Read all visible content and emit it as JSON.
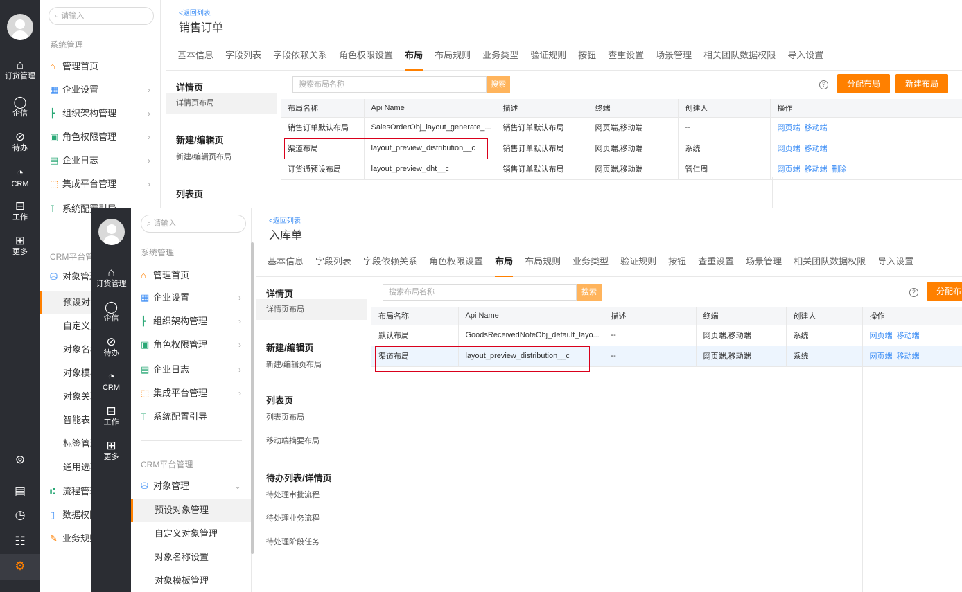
{
  "w1": {
    "rail": [
      {
        "label": "订货管理"
      },
      {
        "label": "企信"
      },
      {
        "label": "待办"
      },
      {
        "label": "CRM"
      },
      {
        "label": "工作"
      },
      {
        "label": "更多"
      }
    ],
    "search_placeholder": "请输入",
    "section_system": "系统管理",
    "menu": [
      "管理首页",
      "企业设置",
      "组织架构管理",
      "角色权限管理",
      "企业日志",
      "集成平台管理",
      "系统配置引导"
    ],
    "section_crm": "CRM平台管",
    "crm_menu": [
      "对象管理",
      "预设对象",
      "自定义对",
      "对象名称",
      "对象模板",
      "对象关联",
      "智能表单",
      "标签管理",
      "通用选项",
      "流程管理",
      "数据权限",
      "业务规则"
    ],
    "back": "<返回列表",
    "title": "销售订单",
    "tabs": [
      "基本信息",
      "字段列表",
      "字段依赖关系",
      "角色权限设置",
      "布局",
      "布局规则",
      "业务类型",
      "验证规则",
      "按钮",
      "查重设置",
      "场景管理",
      "相关团队数据权限",
      "导入设置"
    ],
    "left_nav": {
      "detail_title": "详情页",
      "detail_item": "详情页布局",
      "edit_title": "新建/编辑页",
      "edit_item": "新建/编辑页布局",
      "list_title": "列表页"
    },
    "search_name": "搜索布局名称",
    "search_btn": "搜索",
    "help": "?",
    "assign_btn": "分配布局",
    "new_btn": "新建布局",
    "columns": [
      "布局名称",
      "Api Name",
      "描述",
      "终端",
      "创建人",
      "操作"
    ],
    "rows": [
      {
        "name": "销售订单默认布局",
        "api": "SalesOrderObj_layout_generate_...",
        "desc": "销售订单默认布局",
        "terminal": "网页端,移动端",
        "creator": "--",
        "ops": [
          "网页端",
          "移动端"
        ]
      },
      {
        "name": "渠道布局",
        "api": "layout_preview_distribution__c",
        "desc": "销售订单默认布局",
        "terminal": "网页端,移动端",
        "creator": "系统",
        "ops": [
          "网页端",
          "移动端"
        ]
      },
      {
        "name": "订货通预设布局",
        "api": "layout_preview_dht__c",
        "desc": "销售订单默认布局",
        "terminal": "网页端,移动端",
        "creator": "管仁周",
        "ops": [
          "网页端",
          "移动端",
          "删除"
        ]
      }
    ]
  },
  "w2": {
    "rail": [
      {
        "label": "订货管理"
      },
      {
        "label": "企信"
      },
      {
        "label": "待办"
      },
      {
        "label": "CRM"
      },
      {
        "label": "工作"
      },
      {
        "label": "更多"
      }
    ],
    "search_placeholder": "请输入",
    "section_system": "系统管理",
    "menu": [
      "管理首页",
      "企业设置",
      "组织架构管理",
      "角色权限管理",
      "企业日志",
      "集成平台管理",
      "系统配置引导"
    ],
    "section_crm": "CRM平台管理",
    "crm_group": "对象管理",
    "crm_sub": [
      "预设对象管理",
      "自定义对象管理",
      "对象名称设置",
      "对象模板管理"
    ],
    "back": "<返回列表",
    "title": "入库单",
    "tabs": [
      "基本信息",
      "字段列表",
      "字段依赖关系",
      "角色权限设置",
      "布局",
      "布局规则",
      "业务类型",
      "验证规则",
      "按钮",
      "查重设置",
      "场景管理",
      "相关团队数据权限",
      "导入设置"
    ],
    "left_nav": {
      "detail_title": "详情页",
      "detail_item": "详情页布局",
      "edit_title": "新建/编辑页",
      "edit_item": "新建/编辑页布局",
      "list_title": "列表页",
      "list_item": "列表页布局",
      "mobile_item": "移动端摘要布局",
      "todo_title": "待办列表/详情页",
      "todo_items": [
        "待处理审批流程",
        "待处理业务流程",
        "待处理阶段任务"
      ]
    },
    "search_name": "搜索布局名称",
    "search_btn": "搜索",
    "help": "?",
    "assign_btn": "分配布",
    "columns": [
      "布局名称",
      "Api Name",
      "描述",
      "终端",
      "创建人",
      "操作"
    ],
    "rows": [
      {
        "name": "默认布局",
        "api": "GoodsReceivedNoteObj_default_layo...",
        "desc": "--",
        "terminal": "网页端,移动端",
        "creator": "系统",
        "ops": [
          "网页端",
          "移动端"
        ]
      },
      {
        "name": "渠道布局",
        "api": "layout_preview_distribution__c",
        "desc": "--",
        "terminal": "网页端,移动端",
        "creator": "系统",
        "ops": [
          "网页端",
          "移动端"
        ]
      }
    ]
  },
  "colors": {
    "rail": "#2b2d33",
    "accent": "#ff8000",
    "link": "#3d8ef5",
    "highlight_box": "#d9001b"
  }
}
